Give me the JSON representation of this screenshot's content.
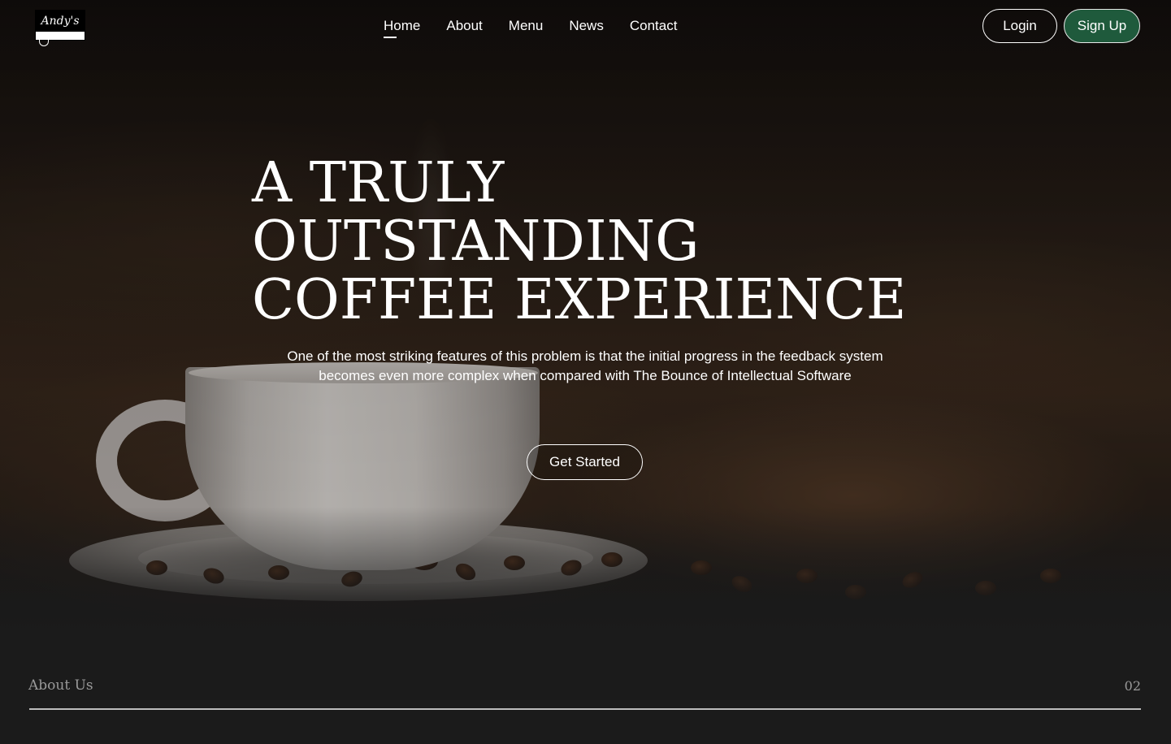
{
  "brand": {
    "logo_text": "Andy's"
  },
  "nav": {
    "items": [
      {
        "label": "Home",
        "active": true
      },
      {
        "label": "About",
        "active": false
      },
      {
        "label": "Menu",
        "active": false
      },
      {
        "label": "News",
        "active": false
      },
      {
        "label": "Contact",
        "active": false
      }
    ]
  },
  "auth": {
    "login_label": "Login",
    "signup_label": "Sign Up"
  },
  "hero": {
    "headline_lines": [
      "A TRULY",
      "OUTSTANDING",
      "COFFEE EXPERIENCE"
    ],
    "subtext": "One of the most striking features of this problem is that the initial progress in the feedback system becomes even more complex when compared with The Bounce of Intellectual Software",
    "cta_label": "Get Started"
  },
  "section": {
    "label": "About Us",
    "number": "02"
  },
  "colors": {
    "accent": "#1f5a3c",
    "background": "#1b1b1b"
  }
}
